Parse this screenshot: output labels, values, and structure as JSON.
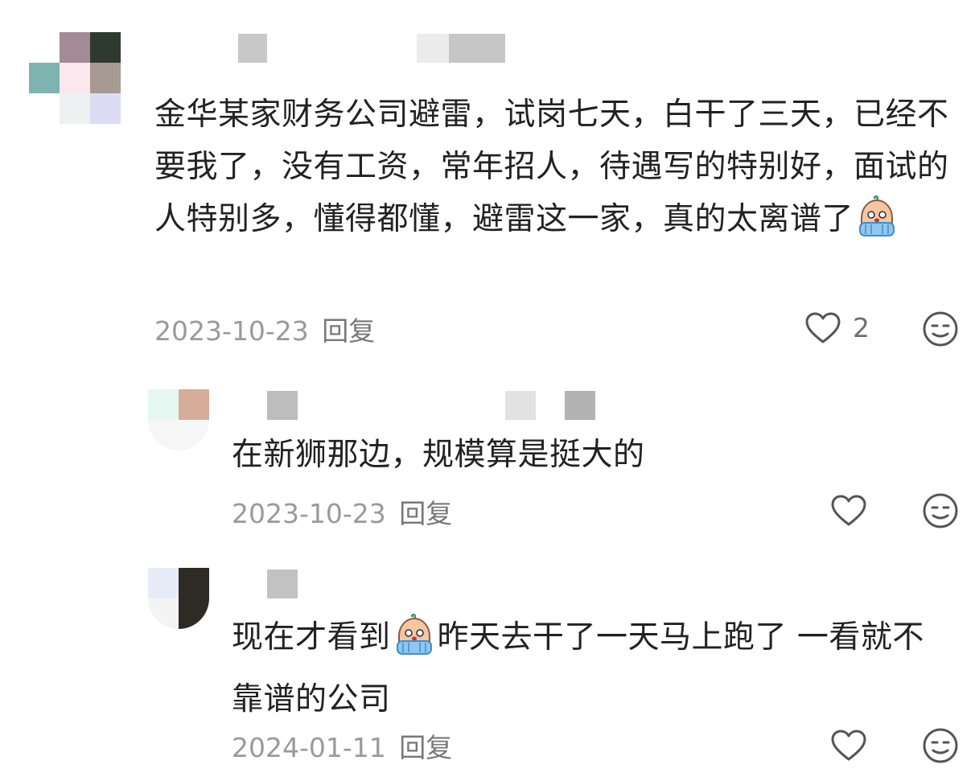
{
  "comments": [
    {
      "text_parts": [
        "金华某家财务公司避雷，试岗七天，白干了三天，已经不要我了，没有工资，常年招人，待遇写的特别好，面试的人特别多，懂得都懂，避雷这一家，真的太离谱了",
        ""
      ],
      "emoji": "crying-emoji",
      "date": "2023-10-23",
      "reply_label": "回复",
      "like_count": "2",
      "avatar_colors": [
        "#a48a96",
        "#2e3930",
        "#7fb3b0",
        "#fbe8ee",
        "#a79a94",
        "#eef1f1",
        "#dcdcf4"
      ]
    },
    {
      "text_parts": [
        "在新狮那边，规模算是挺大的"
      ],
      "date": "2023-10-23",
      "reply_label": "回复",
      "like_count": "",
      "avatar_colors": [
        "#e6f7f1",
        "#d6ad99",
        "#f2f2f2"
      ]
    },
    {
      "text_parts": [
        "现在才看到",
        "昨天去干了一天马上跑了 一看就不靠谱的公司"
      ],
      "emoji": "crying-emoji",
      "date": "2024-01-11",
      "reply_label": "回复",
      "like_count": "",
      "avatar_colors": [
        "#e8ecf8",
        "#2e2a24",
        "#f0f0f0"
      ]
    }
  ],
  "icons": {
    "like": "heart-outline-icon",
    "emoji_reply": "smiley-emoji-icon"
  },
  "colors": {
    "text": "#222222",
    "meta": "#9a9a9a",
    "icon": "#555555"
  }
}
